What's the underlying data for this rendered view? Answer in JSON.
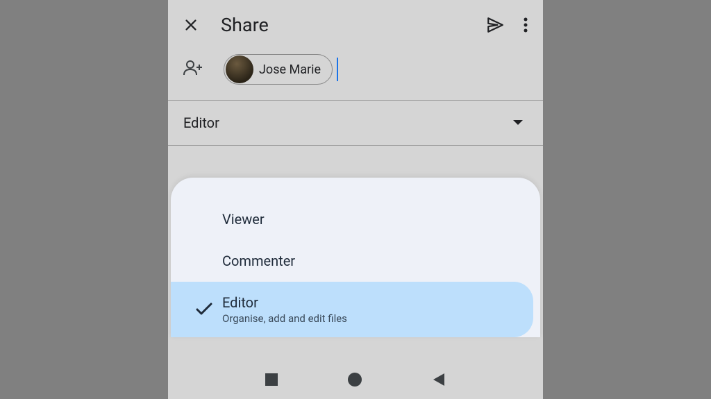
{
  "header": {
    "title": "Share"
  },
  "chip": {
    "name": "Jose Marie"
  },
  "role_dropdown": {
    "current": "Editor"
  },
  "options": [
    {
      "label": "Viewer",
      "sublabel": "",
      "selected": false
    },
    {
      "label": "Commenter",
      "sublabel": "",
      "selected": false
    },
    {
      "label": "Editor",
      "sublabel": "Organise, add and edit files",
      "selected": true
    }
  ]
}
